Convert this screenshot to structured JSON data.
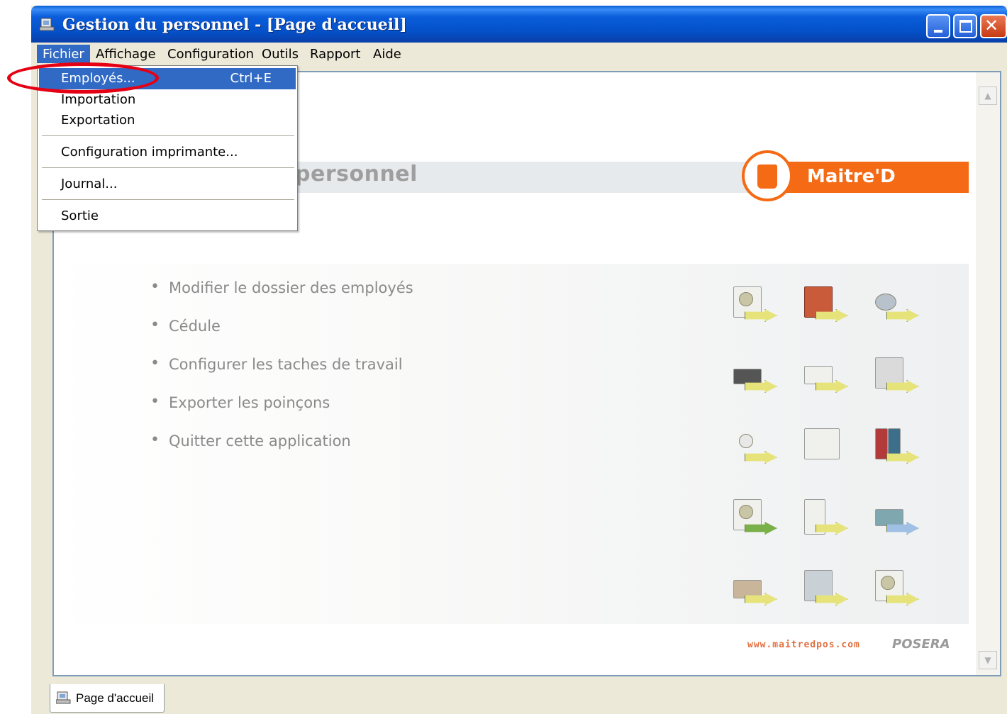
{
  "window": {
    "title": "Gestion du personnel - [Page d'accueil]",
    "icon": "app-icon",
    "controls": [
      "minimize-icon",
      "maximize-icon",
      "close-icon"
    ]
  },
  "menubar": {
    "items": [
      "Fichier",
      "Affichage",
      "Configuration",
      "Outils",
      "Rapport",
      "Aide"
    ],
    "active": "Fichier"
  },
  "fichier_menu": {
    "employes": {
      "label": "Employés...",
      "shortcut": "Ctrl+E",
      "highlighted": true
    },
    "importation": "Importation",
    "exportation": "Exportation",
    "config_imprimante": "Configuration imprimante...",
    "journal": "Journal...",
    "sortie": "Sortie"
  },
  "annotation": {
    "type": "red-ellipse",
    "target": "Employés...",
    "color": "#e60014"
  },
  "banner": {
    "title_visible": "personnel",
    "logo_text": "Maitre'D",
    "accent_color": "#f56a14"
  },
  "links": [
    "Modifier le dossier des employés",
    "Cédule",
    "Configurer les taches de travail",
    "Exporter les poinçons",
    "Quitter cette application"
  ],
  "icon_grid": [
    [
      "document-icon",
      "house-icon",
      "bottle-icon"
    ],
    [
      "laptop-icon",
      "printer-icon",
      "monitor-icon"
    ],
    [
      "pen-icon",
      "paper-stack-icon",
      "books-icon"
    ],
    [
      "computer-icon",
      "server-icon",
      "network-device-icon"
    ],
    [
      "table-icon",
      "screen-icon",
      "display-icon"
    ]
  ],
  "footer": {
    "url": "www.maitredpos.com",
    "company": "POSERA"
  },
  "tabs": [
    {
      "label": "Page d'accueil",
      "icon": "home-icon"
    }
  ]
}
